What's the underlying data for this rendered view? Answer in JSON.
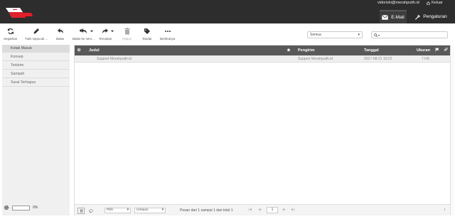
{
  "header": {
    "user_email": "vidorizki@merahputih.id",
    "logout_label": "Keluar",
    "tab_email": "E-Mail",
    "tab_settings": "Pengaturan"
  },
  "toolbar": {
    "refresh": "Segarkan",
    "compose": "Tulis sepucuk ...",
    "reply": "Balas",
    "reply_all": "Balas ke sem...",
    "forward": "Teruskan",
    "delete": "Hapus",
    "mark": "Tandai",
    "more": "Berikutnya"
  },
  "filter": {
    "selected": "Semua"
  },
  "search": {
    "value": ""
  },
  "folders": [
    "Kotak Masuk",
    "Konsep",
    "Terkirim",
    "Sampah",
    "Surat Terhapus"
  ],
  "quota": {
    "percent": "0%"
  },
  "list": {
    "col_subject": "Judul",
    "col_from": "Pengirim",
    "col_date": "Tanggal",
    "col_size": "Ukuran",
    "messages": [
      {
        "subject": "Support Merahputih.id",
        "from": "Support Merahputih.id",
        "date": "2017-08-21 19:22",
        "size": "7 KB"
      }
    ]
  },
  "footer": {
    "select_label": "Pilih",
    "sort_label": "Untaian",
    "count_text": "Pesan dari 1 sampai 1 dari total 1",
    "page": "1"
  },
  "colors": {
    "header_bg": "#2d2d2d",
    "list_header_bg": "#595959",
    "brand_red": "#e0202a"
  }
}
